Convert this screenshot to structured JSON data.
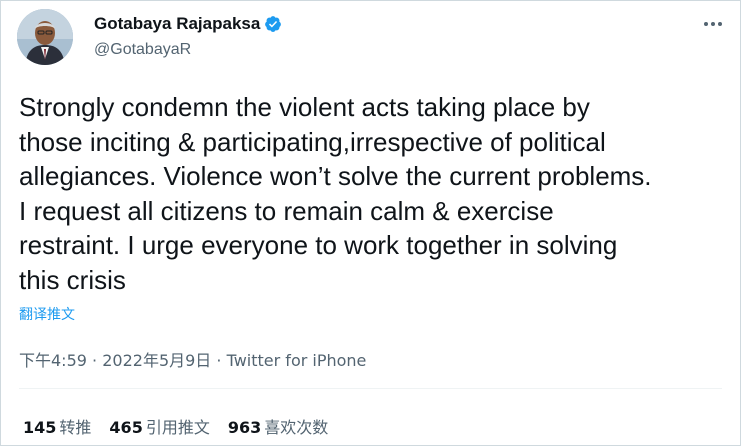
{
  "author": {
    "display_name": "Gotabaya Rajapaksa",
    "handle": "@GotabayaR",
    "verified": true
  },
  "tweet": {
    "text": "Strongly condemn the violent acts taking place by\nthose inciting & participating,irrespective of political\nallegiances. Violence won’t solve the current problems.\nI request all citizens to remain calm & exercise\nrestraint. I urge everyone to work together in solving\nthis crisis",
    "translate_label": "翻译推文",
    "time": "下午4:59",
    "separator": "·",
    "date": "2022年5月9日",
    "source": "Twitter for iPhone"
  },
  "stats": {
    "retweets": {
      "count": "145",
      "label": "转推"
    },
    "quotes": {
      "count": "465",
      "label": "引用推文"
    },
    "likes": {
      "count": "963",
      "label": "喜欢次数"
    }
  },
  "icons": {
    "verified": "verified-badge-icon",
    "more": "more-options-icon"
  },
  "colors": {
    "accent": "#1d9bf0",
    "secondary_text": "#536471",
    "primary_text": "#0f1419"
  }
}
